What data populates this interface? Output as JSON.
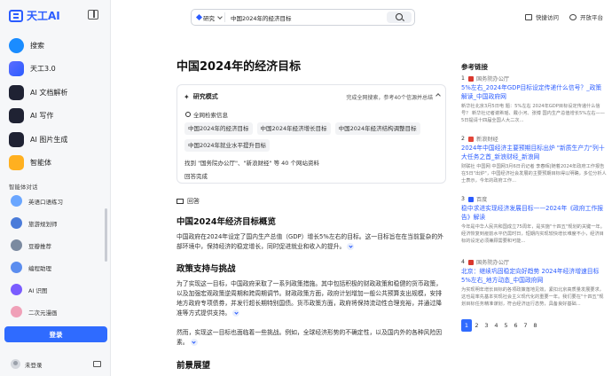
{
  "brand": {
    "name": "天工AI"
  },
  "nav": [
    {
      "label": "搜索",
      "icon": "search-icon",
      "cls": "search"
    },
    {
      "label": "天工3.0",
      "icon": "tiangong-icon",
      "cls": "tg"
    },
    {
      "label": "AI 文档解析",
      "icon": "doc-icon",
      "cls": "doc"
    },
    {
      "label": "AI 写作",
      "icon": "write-icon",
      "cls": "write"
    },
    {
      "label": "AI 图片生成",
      "icon": "image-icon",
      "cls": "img"
    },
    {
      "label": "智能体",
      "icon": "agent-icon",
      "cls": "agent"
    }
  ],
  "agents_title": "智能体对话",
  "agents": [
    {
      "label": "英语口语练习",
      "color": "#6aa6ff"
    },
    {
      "label": "旅游规划师",
      "color": "#4a7bd9"
    },
    {
      "label": "豆瓣推荐",
      "color": "#7b8aa0"
    },
    {
      "label": "编程助理",
      "color": "#5b8def"
    },
    {
      "label": "AI 识图",
      "color": "#7a5cff"
    },
    {
      "label": "二次元漫画",
      "color": "#f0a0b8"
    }
  ],
  "login_label": "登录",
  "user_label": "未登录",
  "search": {
    "mode": "研究",
    "query": "中国2024年的经济目标"
  },
  "topbar": {
    "quick_access": "快捷访问",
    "open_platform": "开放平台"
  },
  "main": {
    "title": "中国2024年的经济目标",
    "research": {
      "title": "研究模式",
      "status": "完成全网搜索，参考40个信源并总结",
      "sub": "全网检索信息",
      "chips": [
        "中国2024年的经济目标",
        "中国2024年经济增长目标",
        "中国2024年经济结构调整目标",
        "中国2024年就业水平提升目标"
      ],
      "found": "找到 \"国务院办公厅\"、\"新浪财经\" 等 40 个网站资料",
      "done": "回答完成"
    },
    "answer_label": "回答",
    "h_overview": "中国2024年经济目标概览",
    "p_overview": "中国政府在2024年设定了国内生产总值（GDP）增长5%左右的目标。这一目标旨在在当前复杂的外部环境中，保持经济的稳定增长，同时促进就业和收入的提升。",
    "h_policy": "政策支持与挑战",
    "p_policy1": "为了实现这一目标，中国政府采取了一系列政策措施。其中包括积极的财政政策和稳健的货币政策，以及加强宏观政策逆周期和跨周期调节。财政政策方面，政府计划增加一般公共预算支出规模，安排地方政府专项债券，并发行超长期特别国债。货币政策方面，政府将保持流动性合理充裕，并通过降准等方式提供支持。",
    "p_policy2": "然而，实现这一目标也面临着一些挑战。例如，全球经济形势的不确定性，以及国内外的各种风险因素。",
    "h_outlook": "前景展望"
  },
  "refs": {
    "title": "参考链接",
    "items": [
      {
        "num": "1",
        "source": "国务院办公厅",
        "src_color": "#d9382e",
        "title": "5%左右_2024年GDP目标设定传递什么信号？_政策解读_中国政府网",
        "snippet": "新华社北京3月5日电 题：5%左右 2024年GDP目标设定传递什么信号？ 新华社记者谢希瑶、戴小河、张博 国内生产总值增长5%左右——5日提请十四届全国人大二次..."
      },
      {
        "num": "2",
        "source": "新浪财经",
        "src_color": "#e2473a",
        "title": "2024年中国经济主要预期目标出炉 \"新质生产力\"列十大任务之首_新浪财经_新浪网",
        "snippet": "财联社  中国网 中国网3月6日讯记者 李春晖|随着2024年政府工作报告在5日\"出炉\"，中国经济社会发展的主要预期目标得以明确，多位分析人士表示，今年的政府工作..."
      },
      {
        "num": "3",
        "source": "百度",
        "src_color": "#2b5cff",
        "title": "稳中求进实现经济发展目标——2024年《政府工作报告》解读",
        "snippet": "今年是中华人民共和国成立75周年，是实施\"十四五\"规划的关键一年。经济恢复到疫前水平仍需时日，短期内实现较快增长难度不小，经济目标的设定必须兼顾需要和可能..."
      },
      {
        "num": "4",
        "source": "国务院办公厅",
        "src_color": "#d9382e",
        "title": "北京：继续巩固稳定向好趋势 2024年经济增速目标5%左右_地方动态_中国政府网",
        "snippet": "为实现明年增长目标的各项政策落地见效，紧扣北京高质量发展要求，这也是率先基本实现社会主义现代化的重要一年。我们要在\"十四五\"规划目标任务精准谋划，符合经济运行态势，具备良好基础..."
      }
    ],
    "pages": [
      "1",
      "2",
      "3",
      "4",
      "5",
      "6",
      "7",
      "8"
    ]
  }
}
